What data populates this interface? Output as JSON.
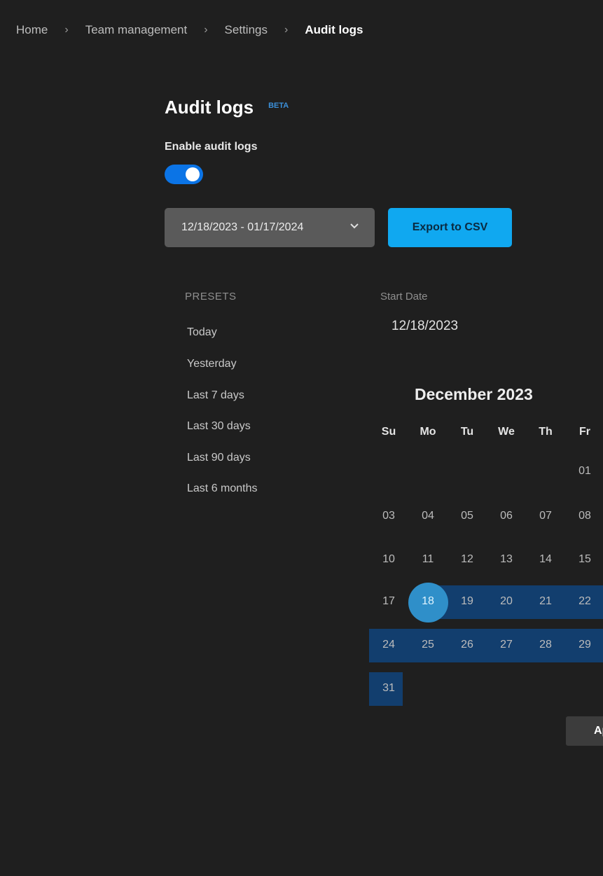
{
  "breadcrumb": {
    "items": [
      "Home",
      "Team management",
      "Settings",
      "Audit logs"
    ]
  },
  "header": {
    "title": "Audit logs",
    "badge": "BETA"
  },
  "toggle": {
    "label": "Enable audit logs",
    "on": true
  },
  "controls": {
    "range_value": "12/18/2023 - 01/17/2024",
    "export_label": "Export to CSV"
  },
  "presets": {
    "title": "PRESETS",
    "items": [
      "Today",
      "Yesterday",
      "Last 7 days",
      "Last 30 days",
      "Last 90 days",
      "Last 6 months"
    ]
  },
  "datepicker": {
    "start_label": "Start Date",
    "start_value": "12/18/2023",
    "month_title": "December 2023",
    "weekdays": [
      "Su",
      "Mo",
      "Tu",
      "We",
      "Th",
      "Fr"
    ],
    "weeks": [
      [
        "",
        "",
        "",
        "",
        "",
        "01"
      ],
      [
        "03",
        "04",
        "05",
        "06",
        "07",
        "08"
      ],
      [
        "10",
        "11",
        "12",
        "13",
        "14",
        "15"
      ],
      [
        "17",
        "18",
        "19",
        "20",
        "21",
        "22"
      ],
      [
        "24",
        "25",
        "26",
        "27",
        "28",
        "29"
      ],
      [
        "31",
        "",
        "",
        "",
        "",
        ""
      ]
    ],
    "selected_day": "18",
    "apply_label": "Apply"
  },
  "colors": {
    "accent": "#10a8f0",
    "toggle": "#0b74e6",
    "range_band": "#123e6e",
    "selected": "#2f8fc9"
  }
}
